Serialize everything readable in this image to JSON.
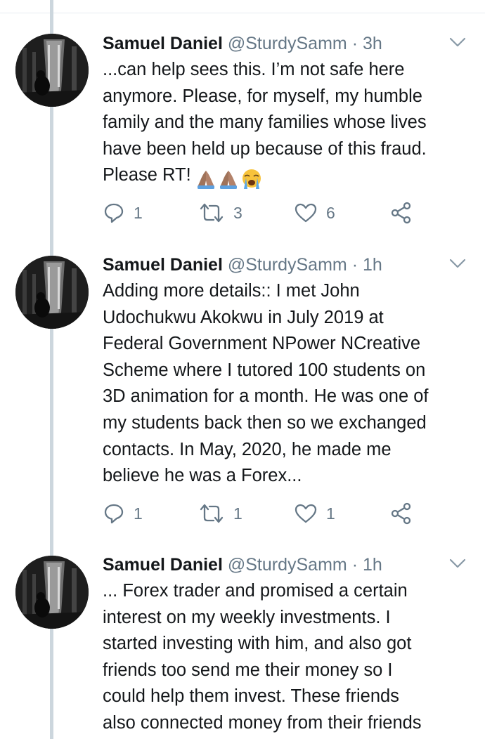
{
  "tweets": [
    {
      "name": "Samuel Daniel",
      "handle": "@SturdySamm",
      "separator": "·",
      "time": "3h",
      "text": "...can help sees this. I’m not safe here\nanymore. Please, for myself, my humble\nfamily and the many families whose lives\nhave been held up because of this fraud.\nPlease RT!",
      "emojis": [
        "folded-hands-emoji",
        "folded-hands-emoji",
        "loudly-crying-face-emoji"
      ],
      "replies": "1",
      "retweets": "3",
      "likes": "6"
    },
    {
      "name": "Samuel Daniel",
      "handle": "@SturdySamm",
      "separator": "·",
      "time": "1h",
      "text": "Adding more details:: I met John\nUdochukwu Akokwu in July 2019 at\nFederal Government NPower NCreative\nScheme where I tutored 100 students on\n3D animation for a month. He was one of\nmy students back then so we exchanged\ncontacts. In May, 2020, he made me\nbelieve he was a Forex...",
      "replies": "1",
      "retweets": "1",
      "likes": "1"
    },
    {
      "name": "Samuel Daniel",
      "handle": "@SturdySamm",
      "separator": "·",
      "time": "1h",
      "text": "... Forex trader and promised a certain\ninterest on my weekly investments. I\nstarted investing with him, and also got\nfriends too send me their money so I\ncould help them invest. These friends\nalso connected money from their friends"
    }
  ],
  "icons": {
    "reply": "reply-icon",
    "retweet": "retweet-icon",
    "like": "heart-icon",
    "share": "share-icon",
    "caret": "chevron-down-icon"
  },
  "colors": {
    "text": "#14171a",
    "secondary": "#657786",
    "thread_line": "#ccd6dd",
    "divider": "#e6ecf0"
  }
}
